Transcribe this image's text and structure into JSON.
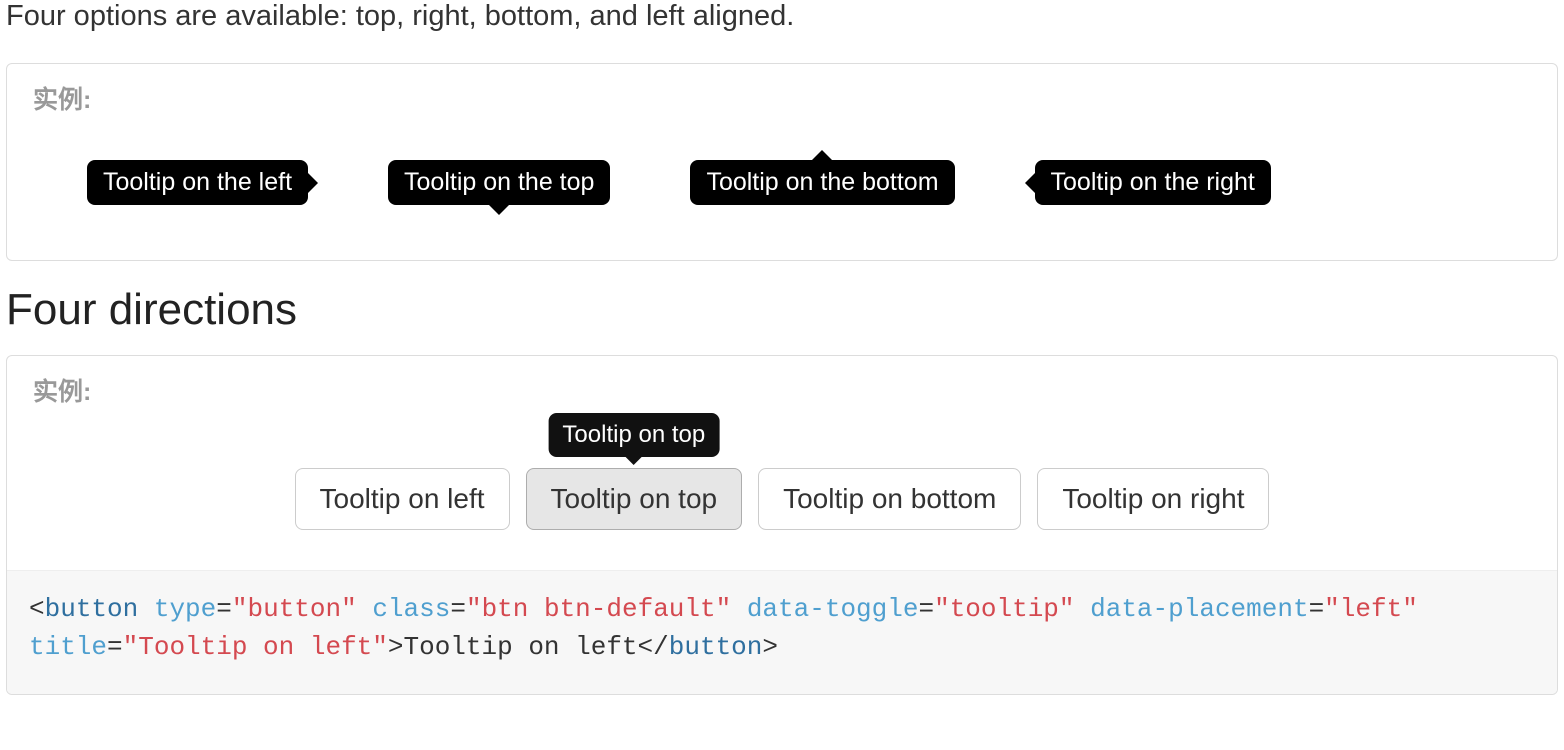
{
  "intro_text": "Four options are available: top, right, bottom, and left aligned.",
  "panel_label": "实例:",
  "tooltips_demo": {
    "left": "Tooltip on the left",
    "top": "Tooltip on the top",
    "bottom": "Tooltip on the bottom",
    "right": "Tooltip on the right"
  },
  "section_title": "Four directions",
  "buttons": {
    "left": "Tooltip on left",
    "top": "Tooltip on top",
    "bottom": "Tooltip on bottom",
    "right": "Tooltip on right"
  },
  "active_tooltip_text": "Tooltip on top",
  "code": {
    "tag_open": "button",
    "attrs": {
      "type": {
        "name": "type",
        "value": "button"
      },
      "class": {
        "name": "class",
        "value": "btn btn-default"
      },
      "toggle": {
        "name": "data-toggle",
        "value": "tooltip"
      },
      "placement": {
        "name": "data-placement",
        "value": "left"
      },
      "title": {
        "name": "title",
        "value": "Tooltip on left"
      }
    },
    "inner_text": "Tooltip on left",
    "tag_close": "button"
  }
}
